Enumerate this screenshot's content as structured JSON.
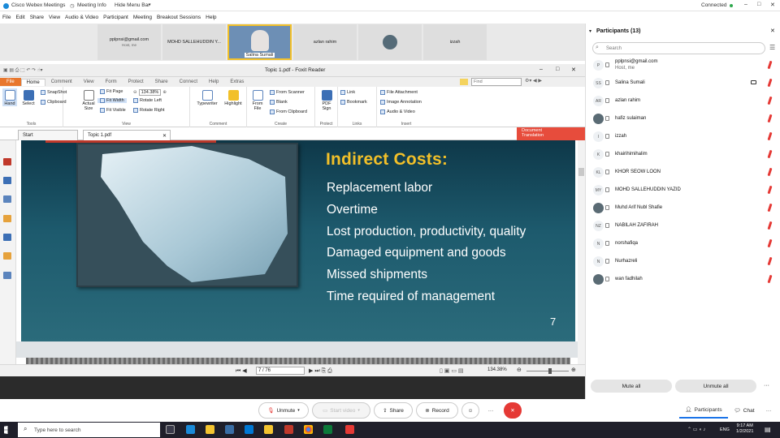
{
  "window": {
    "app_title": "Cisco Webex Meetings",
    "meeting_info": "Meeting Info",
    "hide_menu": "Hide Menu Bar",
    "status": "Connected"
  },
  "menu": [
    "File",
    "Edit",
    "Share",
    "View",
    "Audio & Video",
    "Participant",
    "Meeting",
    "Breakout Sessions",
    "Help"
  ],
  "video": [
    {
      "name": "pplpnsi@gmail.com",
      "sub": "Host, me"
    },
    {
      "name": "MOHD SALLEHUDDIN Y...",
      "sub": ""
    },
    {
      "name": "Salina Sumali",
      "sub": ""
    },
    {
      "name": "azlan rahim",
      "sub": ""
    },
    {
      "name": "",
      "sub": ""
    },
    {
      "name": "izzah",
      "sub": ""
    }
  ],
  "foxit": {
    "title": "Topic 1.pdf - Foxit Reader",
    "find_placeholder": "Find",
    "tabs": [
      "File",
      "Home",
      "Comment",
      "View",
      "Form",
      "Protect",
      "Share",
      "Connect",
      "Help",
      "Extras"
    ],
    "tools": {
      "hand": "Hand",
      "select": "Select",
      "snapshot": "SnapShot",
      "clipboard": "Clipboard",
      "group": "Tools"
    },
    "view": {
      "actual": "Actual",
      "size": "Size",
      "fit_page": "Fit Page",
      "fit_width": "Fit Width",
      "fit_visible": "Fit Visible",
      "zoom": "134.38%",
      "rotate_left": "Rotate Left",
      "rotate_right": "Rotate Right",
      "group": "View"
    },
    "comment": {
      "typewriter": "Typewriter",
      "highlight": "Highlight",
      "group": "Comment"
    },
    "create": {
      "from": "From",
      "file": "File",
      "scanner": "From Scanner",
      "blank": "Blank",
      "clipboard": "From Clipboard",
      "group": "Create"
    },
    "protect": {
      "pdf": "PDF",
      "sign": "Sign",
      "group": "Protect"
    },
    "links": {
      "link": "Link",
      "bookmark": "Bookmark",
      "group": "Links"
    },
    "insert": {
      "attachment": "File Attachment",
      "image": "Image Annotation",
      "audio": "Audio & Video",
      "group": "Insert"
    },
    "doc_tabs": [
      "Start",
      "Topic 1.pdf"
    ],
    "doc_translation": [
      "Document",
      "Translation"
    ],
    "page_field": "7 / 76",
    "zoom_status": "134.38%"
  },
  "slide": {
    "heading": "Indirect Costs:",
    "bullets": [
      "Replacement labor",
      "Overtime",
      "Lost production, productivity, quality",
      "Damaged equipment and goods",
      "Missed shipments",
      "Time required of management"
    ],
    "page_number": "7"
  },
  "controls": {
    "unmute": "Unmute",
    "start_video": "Start video",
    "share": "Share",
    "record": "Record"
  },
  "participants": {
    "header": "Participants (13)",
    "search_placeholder": "Search",
    "list": [
      {
        "initials": "P",
        "name": "pplpnsi@gmail.com",
        "sub": "Host, me"
      },
      {
        "initials": "SS",
        "name": "Salina Sumali",
        "sub": ""
      },
      {
        "initials": "AR",
        "name": "azlan rahim",
        "sub": ""
      },
      {
        "initials": "",
        "name": "hafiz sulaiman",
        "sub": ""
      },
      {
        "initials": "I",
        "name": "izzah",
        "sub": ""
      },
      {
        "initials": "K",
        "name": "khairihimihalim",
        "sub": ""
      },
      {
        "initials": "KL",
        "name": "KHOR SEOW LOON",
        "sub": ""
      },
      {
        "initials": "MY",
        "name": "MOHD SALLEHUDDIN YAZID",
        "sub": ""
      },
      {
        "initials": "",
        "name": "Muhd Arif Nubl Shafie",
        "sub": ""
      },
      {
        "initials": "NZ",
        "name": "NABILAH ZAFIRAH",
        "sub": ""
      },
      {
        "initials": "N",
        "name": "norshafiqa",
        "sub": ""
      },
      {
        "initials": "N",
        "name": "Nurhazreli",
        "sub": ""
      },
      {
        "initials": "",
        "name": "wan fadhilah",
        "sub": ""
      }
    ],
    "mute_all": "Mute all",
    "unmute_all": "Unmute all",
    "tab_participants": "Participants",
    "tab_chat": "Chat"
  },
  "taskbar": {
    "search_placeholder": "Type here to search",
    "time": "9:17 AM",
    "date": "1/2/2021",
    "lang": "ENG"
  },
  "colors": {
    "foxit_file": "#e8772e",
    "slide_heading": "#f2c029",
    "end_button": "#e53935"
  }
}
